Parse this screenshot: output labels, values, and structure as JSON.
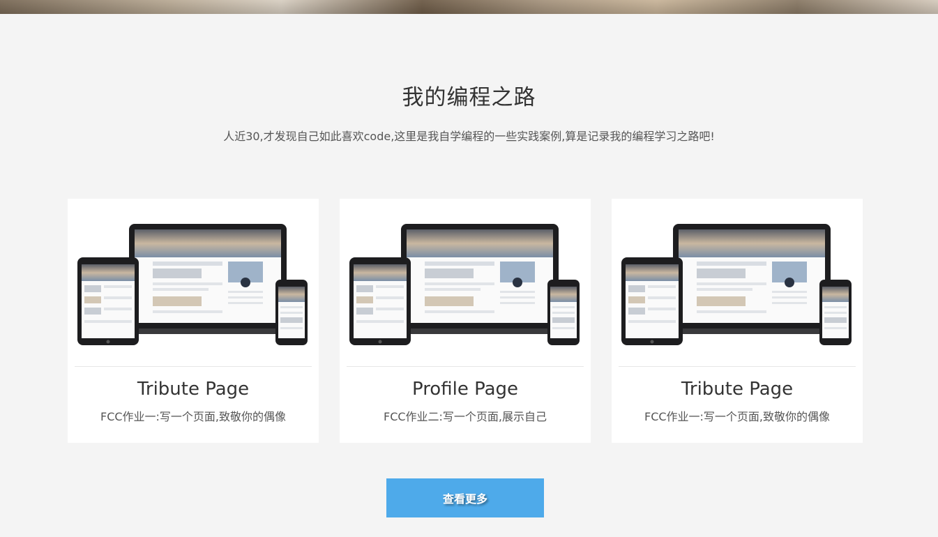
{
  "section": {
    "title": "我的编程之路",
    "subtitle": "人近30,才发现自己如此喜欢code,这里是我自学编程的一些实践案例,算是记录我的编程学习之路吧!"
  },
  "cards": [
    {
      "title": "Tribute Page",
      "desc": "FCC作业一:写一个页面,致敬你的偶像"
    },
    {
      "title": "Profile Page",
      "desc": "FCC作业二:写一个页面,展示自己"
    },
    {
      "title": "Tribute Page",
      "desc": "FCC作业一:写一个页面,致敬你的偶像"
    }
  ],
  "more_button": {
    "label": "查看更多"
  },
  "colors": {
    "accent": "#4eaaea",
    "page_bg": "#f4f4f4"
  }
}
